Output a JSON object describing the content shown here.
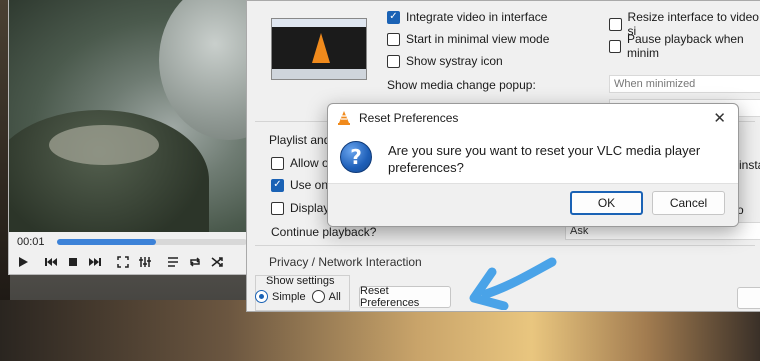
{
  "player": {
    "time": "00:01",
    "progress_percent": 52,
    "controls": [
      "play-icon",
      "previous-icon",
      "stop-icon",
      "next-icon",
      "fullscreen-icon",
      "equalizer-icon",
      "playlist-icon",
      "loop-icon",
      "shuffle-icon"
    ]
  },
  "prefs": {
    "integrate_video": "Integrate video in interface",
    "resize_interface": "Resize interface to video si",
    "minimal_view": "Start in minimal view mode",
    "pause_minimized": "Pause playback when minim",
    "systray": "Show systray icon",
    "media_popup_label": "Show media change popup:",
    "media_popup_value": "When minimized",
    "hidden_label": "",
    "playlist_group": "Playlist and I",
    "allow_one": "Allow o",
    "use_only": "Use only",
    "display": "Display p",
    "continue_label": "Continue playback?",
    "continue_value": "Ask",
    "instance_frag": "instance",
    "o_frag": "o",
    "privacy_group": "Privacy / Network Interaction",
    "show_settings": "Show settings",
    "simple": "Simple",
    "all": "All",
    "reset_button": "Reset Preferences"
  },
  "dialog": {
    "title": "Reset Preferences",
    "message": "Are you sure you want to reset your VLC media player preferences?",
    "ok": "OK",
    "cancel": "Cancel"
  },
  "colors": {
    "accent": "#1a62b5",
    "arrow": "#4aa3e8",
    "vlc_orange": "#f08a1c"
  }
}
